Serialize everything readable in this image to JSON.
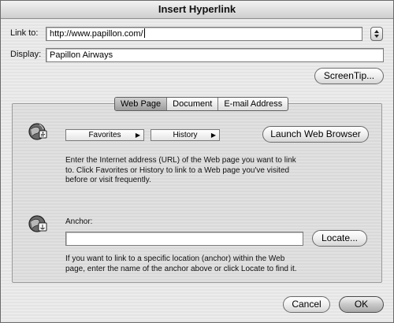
{
  "window": {
    "title": "Insert Hyperlink"
  },
  "link_to": {
    "label": "Link to:",
    "value": "http://www.papillon.com/"
  },
  "display": {
    "label": "Display:",
    "value": "Papillon Airways"
  },
  "buttons": {
    "screentip": "ScreenTip...",
    "launch_browser": "Launch Web Browser",
    "locate": "Locate...",
    "cancel": "Cancel",
    "ok": "OK"
  },
  "tabs": [
    {
      "label": "Web Page",
      "selected": true
    },
    {
      "label": "Document",
      "selected": false
    },
    {
      "label": "E-mail Address",
      "selected": false
    }
  ],
  "menus": {
    "favorites": "Favorites",
    "history": "History"
  },
  "help": {
    "url_instructions": [
      "Enter the Internet address (URL) of the Web page you want to link",
      "to. Click Favorites or History to link to a Web page you've visited",
      "before or visit frequently."
    ],
    "anchor_instructions": [
      "If you want to link to a specific location (anchor) within the Web",
      "page, enter the name of the anchor above or click Locate to find it."
    ]
  },
  "anchor": {
    "label": "Anchor:",
    "value": ""
  },
  "icons": {
    "globe": "globe-link-icon",
    "anchor": "anchor-link-icon",
    "menu_arrow": "triangle-right-icon",
    "popup": "up-down-arrows-icon"
  }
}
